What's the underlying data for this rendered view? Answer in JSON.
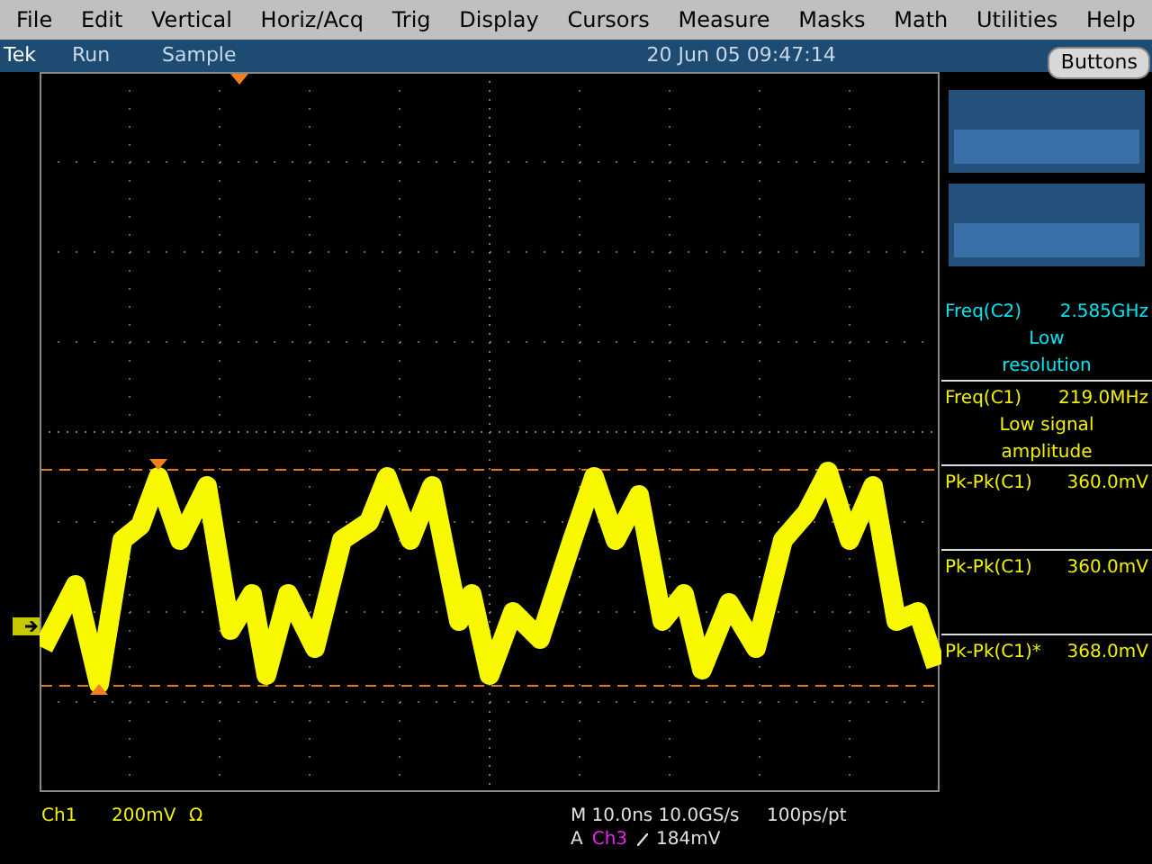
{
  "menu": [
    "File",
    "Edit",
    "Vertical",
    "Horiz/Acq",
    "Trig",
    "Display",
    "Cursors",
    "Measure",
    "Masks",
    "Math",
    "Utilities",
    "Help"
  ],
  "status_bar": {
    "brand": "Tek",
    "state": "Run",
    "mode": "Sample",
    "timestamp": "20 Jun 05 09:47:14"
  },
  "buttons_label": "Buttons",
  "readouts": [
    {
      "label": "Freq(C2)",
      "value": "2.585GHz",
      "note": "Low resolution",
      "color": "#00e6f0"
    },
    {
      "label": "Freq(C1)",
      "value": "219.0MHz",
      "note": "Low signal amplitude",
      "color": "#f0f000"
    },
    {
      "label": "Pk-Pk(C1)",
      "value": "360.0mV",
      "color": "#f0f000"
    },
    {
      "label": "Pk-Pk(C1)",
      "value": "360.0mV",
      "color": "#f0f000"
    },
    {
      "label": "Pk-Pk(C1)*",
      "value": "368.0mV",
      "color": "#f0f000"
    }
  ],
  "channel": {
    "name": "Ch1",
    "scale": "200mV",
    "coupling": "Ω"
  },
  "timebase": {
    "horizontal": "M 10.0ns 10.0GS/s",
    "resolution": "100ps/pt",
    "trigger_mode": "A",
    "trigger_source": "Ch3",
    "trigger_level": "184mV"
  }
}
